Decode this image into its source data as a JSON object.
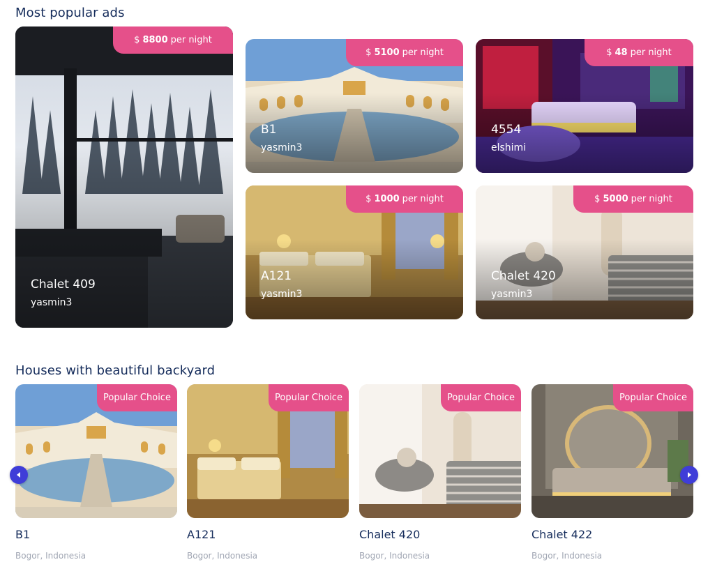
{
  "sections": {
    "popular_title": "Most popular ads",
    "backyard_title": "Houses with beautiful backyard"
  },
  "popular_ads": [
    {
      "name": "Chalet 409",
      "owner": "yasmin3",
      "currency": "$",
      "price": "8800",
      "unit": "per night"
    },
    {
      "name": "B1",
      "owner": "yasmin3",
      "currency": "$",
      "price": "5100",
      "unit": "per night"
    },
    {
      "name": "4554",
      "owner": "elshimi",
      "currency": "$",
      "price": "48",
      "unit": "per night"
    },
    {
      "name": "A121",
      "owner": "yasmin3",
      "currency": "$",
      "price": "1000",
      "unit": "per night"
    },
    {
      "name": "Chalet 420",
      "owner": "yasmin3",
      "currency": "$",
      "price": "5000",
      "unit": "per night"
    }
  ],
  "backyard_houses": [
    {
      "name": "B1",
      "location": "Bogor, Indonesia",
      "badge": "Popular Choice"
    },
    {
      "name": "A121",
      "location": "Bogor, Indonesia",
      "badge": "Popular Choice"
    },
    {
      "name": "Chalet 420",
      "location": "Bogor, Indonesia",
      "badge": "Popular Choice"
    },
    {
      "name": "Chalet 422",
      "location": "Bogor, Indonesia",
      "badge": "Popular Choice"
    }
  ],
  "icons": {
    "prev": "chevron-left-icon",
    "next": "chevron-right-icon"
  },
  "colors": {
    "accent": "#e5508a",
    "heading": "#152c5b",
    "muted": "#a0a6b3",
    "carousel_arrow": "#3f3dd8"
  }
}
